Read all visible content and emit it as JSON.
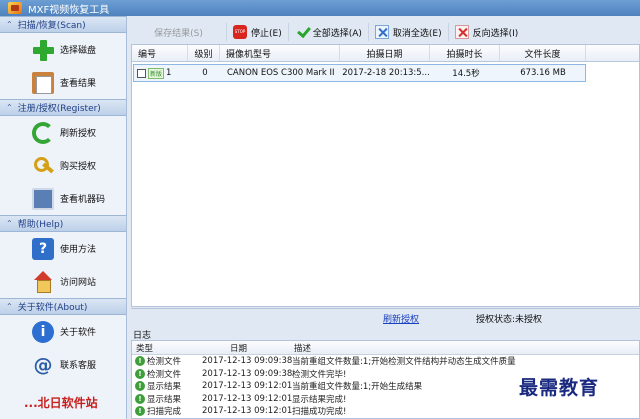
{
  "window": {
    "title": "MXF视频恢复工具"
  },
  "sidebar": {
    "sections": [
      {
        "header": "扫描/恢复(Scan)",
        "items": [
          {
            "label": "选择磁盘",
            "icon": "plus-icon"
          },
          {
            "label": "查看结果",
            "icon": "clipboard-icon"
          }
        ]
      },
      {
        "header": "注册/授权(Register)",
        "items": [
          {
            "label": "刷新授权",
            "icon": "refresh-icon"
          },
          {
            "label": "购买授权",
            "icon": "key-icon"
          },
          {
            "label": "查看机器码",
            "icon": "computer-icon"
          }
        ]
      },
      {
        "header": "帮助(Help)",
        "items": [
          {
            "label": "使用方法",
            "icon": "help-book-icon"
          },
          {
            "label": "访问网站",
            "icon": "home-icon"
          }
        ]
      },
      {
        "header": "关于软件(About)",
        "items": [
          {
            "label": "关于软件",
            "icon": "info-icon"
          },
          {
            "label": "联系客服",
            "icon": "at-icon"
          }
        ]
      }
    ],
    "logo_text": "...北日软件站"
  },
  "toolbar": {
    "save_results": "保存结果(S)",
    "stop": "停止(E)",
    "select_all": "全部选择(A)",
    "deselect_all": "取消全选(E)",
    "invert_selection": "反向选择(I)"
  },
  "table": {
    "columns": [
      "编号",
      "级别",
      "摄像机型号",
      "拍摄日期",
      "拍摄时长",
      "文件长度"
    ],
    "rows": [
      {
        "badge": "新版",
        "id": "1",
        "level": "0",
        "camera": "CANON EOS C300 Mark II",
        "date": "2017-2-18 20:13:5...",
        "duration": "14.5秒",
        "size": "673.16 MB"
      }
    ]
  },
  "status": {
    "refresh_license": "刷新授权",
    "license_status": "授权状态:未授权"
  },
  "log": {
    "label": "日志",
    "columns": [
      "类型",
      "日期",
      "描述"
    ],
    "rows": [
      {
        "type": "检测文件",
        "date": "2017-12-13 09:09:38",
        "desc": "当前重组文件数量:1;开始检测文件结构并动态生成文件质量"
      },
      {
        "type": "检测文件",
        "date": "2017-12-13 09:09:38",
        "desc": "检测文件完毕!"
      },
      {
        "type": "显示结果",
        "date": "2017-12-13 09:12:01",
        "desc": "当前重组文件数量:1;开始生成结果"
      },
      {
        "type": "显示结果",
        "date": "2017-12-13 09:12:01",
        "desc": "显示结果完成!"
      },
      {
        "type": "扫描完成",
        "date": "2017-12-13 09:12:01",
        "desc": "扫描成功完成!"
      }
    ]
  },
  "watermark": "最需教育"
}
